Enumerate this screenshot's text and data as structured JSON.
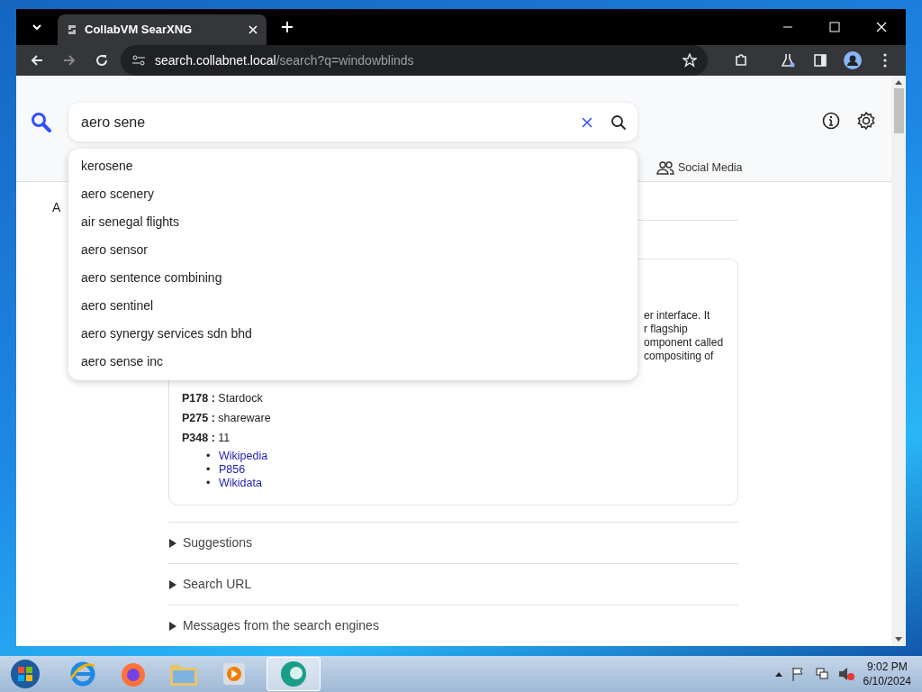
{
  "browser": {
    "tab_title": "CollabVM SearXNG",
    "url_host": "search.collabnet.local",
    "url_path": "/search?q=windowblinds"
  },
  "search": {
    "value": "aero sene",
    "suggestions": [
      "kerosene",
      "aero scenery",
      "air senegal flights",
      "aero sensor",
      "aero sentence combining",
      "aero sentinel",
      "aero synergy services sdn bhd",
      "aero sense inc"
    ]
  },
  "categories": [
    {
      "label": "Social Media"
    }
  ],
  "partial_text": "A",
  "infobox": {
    "fragments": [
      "er interface. It",
      "r flagship",
      "omponent called",
      "compositing of"
    ],
    "attributes": [
      {
        "key": "P178 :",
        "value": "Stardock"
      },
      {
        "key": "P275 :",
        "value": "shareware"
      },
      {
        "key": "P348 :",
        "value": "11"
      }
    ],
    "links": [
      {
        "bullet": "•",
        "label": "Wikipedia"
      },
      {
        "bullet": "•",
        "label": "P856"
      },
      {
        "bullet": "•",
        "label": "Wikidata"
      }
    ]
  },
  "sections": [
    {
      "label": "Suggestions",
      "expanded": false
    },
    {
      "label": "Search URL",
      "expanded": false
    },
    {
      "label": "Messages from the search engines",
      "expanded": false
    }
  ],
  "taskbar": {
    "time": "9:02 PM",
    "date": "6/10/2024"
  }
}
